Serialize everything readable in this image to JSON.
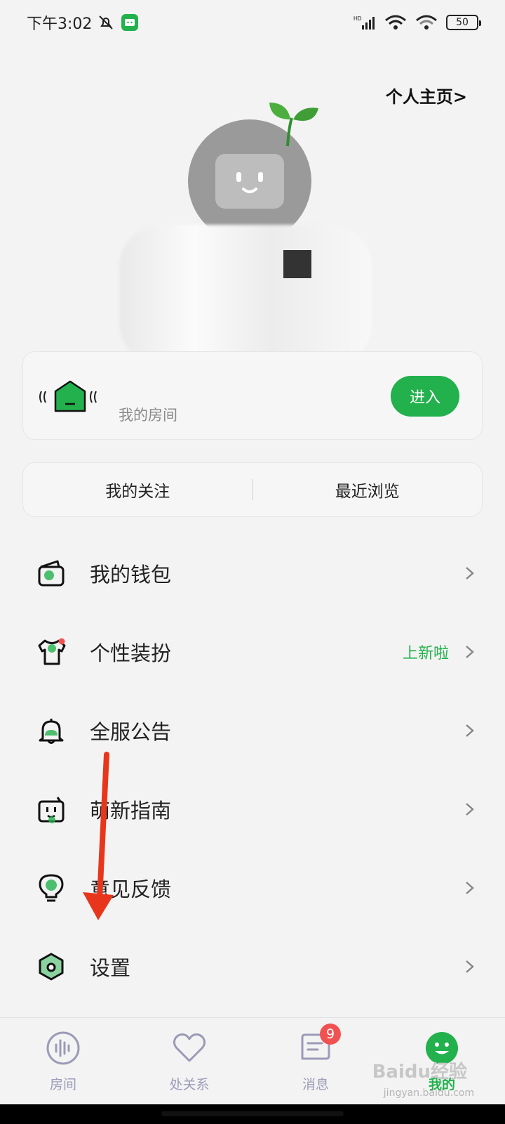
{
  "status_bar": {
    "time": "下午3:02",
    "battery": "50"
  },
  "header": {
    "profile_link": "个人主页>"
  },
  "room": {
    "label": "我的房间",
    "enter_label": "进入"
  },
  "tabs": [
    {
      "label": "我的关注"
    },
    {
      "label": "最近浏览"
    }
  ],
  "menu": [
    {
      "label": "我的钱包",
      "icon": "wallet-icon"
    },
    {
      "label": "个性装扮",
      "extra": "上新啦",
      "icon": "shirt-icon"
    },
    {
      "label": "全服公告",
      "icon": "bell-icon"
    },
    {
      "label": "萌新指南",
      "icon": "robot-icon"
    },
    {
      "label": "意见反馈",
      "icon": "lightbulb-icon"
    },
    {
      "label": "设置",
      "icon": "settings-hexagon-icon"
    }
  ],
  "bottom_nav": [
    {
      "label": "房间",
      "icon": "audio-wave-icon"
    },
    {
      "label": "处关系",
      "icon": "heart-icon"
    },
    {
      "label": "消息",
      "icon": "message-icon",
      "badge": "9"
    },
    {
      "label": "我的",
      "icon": "smiley-icon",
      "active": true
    }
  ],
  "watermark": {
    "text": "Baidu经验",
    "url": "jingyan.baidu.com"
  },
  "colors": {
    "accent": "#22b14c",
    "background": "#f3f3f3",
    "badge": "#f05252",
    "arrow": "#e8361c"
  }
}
